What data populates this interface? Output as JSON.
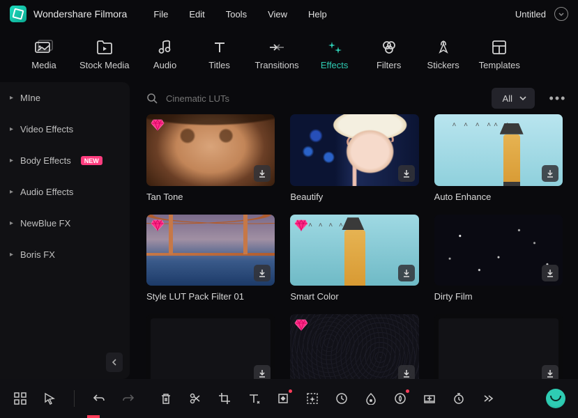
{
  "app_title": "Wondershare Filmora",
  "project_name": "Untitled",
  "menu": {
    "file": "File",
    "edit": "Edit",
    "tools": "Tools",
    "view": "View",
    "help": "Help"
  },
  "categories": {
    "media": "Media",
    "stock_media": "Stock Media",
    "audio": "Audio",
    "titles": "Titles",
    "transitions": "Transitions",
    "effects": "Effects",
    "filters": "Filters",
    "stickers": "Stickers",
    "templates": "Templates"
  },
  "active_category": "effects",
  "sidebar": {
    "items": [
      {
        "label": "MIne",
        "new": false
      },
      {
        "label": "Video Effects",
        "new": false
      },
      {
        "label": "Body Effects",
        "new": true
      },
      {
        "label": "Audio Effects",
        "new": false
      },
      {
        "label": "NewBlue FX",
        "new": false
      },
      {
        "label": "Boris FX",
        "new": false
      }
    ],
    "new_badge_text": "NEW"
  },
  "search": {
    "placeholder": "Cinematic LUTs"
  },
  "filter": {
    "label": "All"
  },
  "effects": [
    {
      "label": "Tan Tone",
      "premium": true,
      "thumb": "tanface"
    },
    {
      "label": "Beautify",
      "premium": false,
      "thumb": "beautify"
    },
    {
      "label": "Auto Enhance",
      "premium": false,
      "thumb": "lighthouse"
    },
    {
      "label": "Style LUT Pack Filter 01",
      "premium": true,
      "thumb": "bridge"
    },
    {
      "label": "Smart Color",
      "premium": true,
      "thumb": "smart"
    },
    {
      "label": "Dirty Film",
      "premium": false,
      "thumb": "dirty"
    },
    {
      "label": "",
      "premium": false,
      "thumb": "partial-dark"
    },
    {
      "label": "",
      "premium": true,
      "thumb": "partial-noise"
    },
    {
      "label": "",
      "premium": false,
      "thumb": "partial-dark"
    }
  ]
}
